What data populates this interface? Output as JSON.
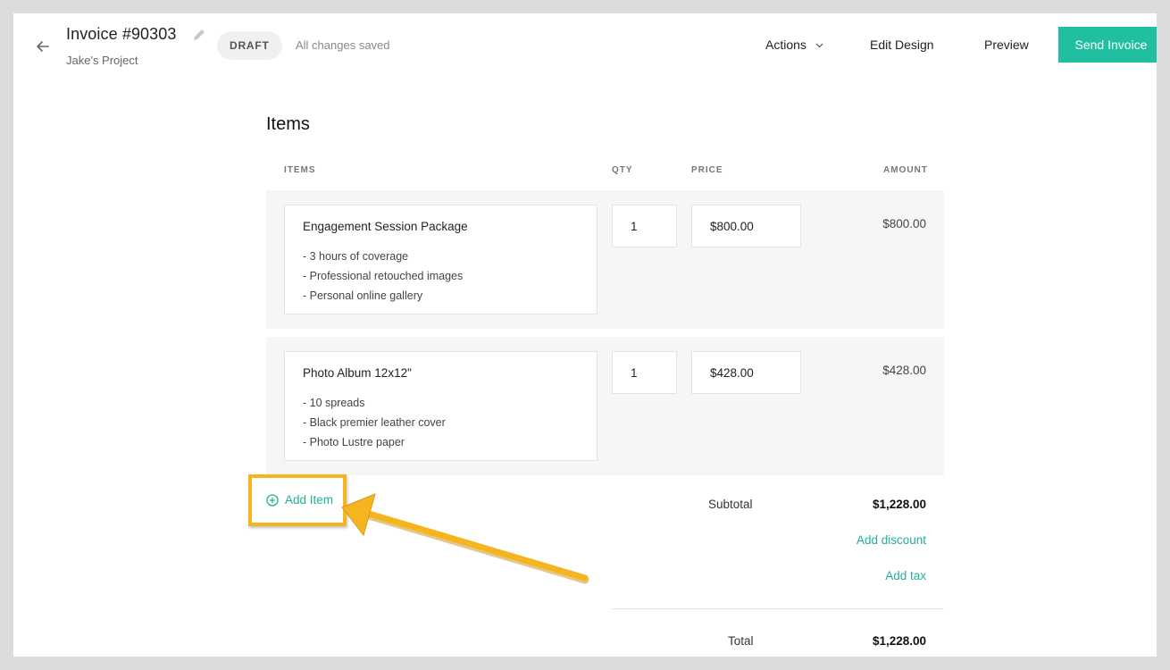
{
  "header": {
    "title": "Invoice #90303",
    "project": "Jake's Project",
    "status_badge": "DRAFT",
    "save_status": "All changes saved",
    "actions_label": "Actions",
    "edit_design_label": "Edit Design",
    "preview_label": "Preview",
    "send_label": "Send Invoice"
  },
  "items_section": {
    "title": "Items",
    "columns": {
      "items": "ITEMS",
      "qty": "QTY",
      "price": "PRICE",
      "amount": "AMOUNT"
    },
    "rows": [
      {
        "name": "Engagement Session Package",
        "details": [
          "- 3 hours of coverage",
          "- Professional retouched images",
          "- Personal online gallery"
        ],
        "qty": "1",
        "price": "$800.00",
        "amount": "$800.00"
      },
      {
        "name": "Photo Album 12x12\"",
        "details": [
          "- 10 spreads",
          "- Black premier leather cover",
          "- Photo Lustre paper"
        ],
        "qty": "1",
        "price": "$428.00",
        "amount": "$428.00"
      }
    ],
    "add_item_label": "Add Item"
  },
  "totals": {
    "subtotal_label": "Subtotal",
    "subtotal_value": "$1,228.00",
    "add_discount_label": "Add discount",
    "add_tax_label": "Add tax",
    "total_label": "Total",
    "total_value": "$1,228.00"
  },
  "colors": {
    "accent": "#20bf9f",
    "link": "#20b094",
    "highlight": "#f5b51f"
  },
  "icons": {
    "back": "arrow-left-icon",
    "edit": "pencil-icon",
    "dropdown": "chevron-down-icon",
    "add": "plus-circle-icon"
  }
}
